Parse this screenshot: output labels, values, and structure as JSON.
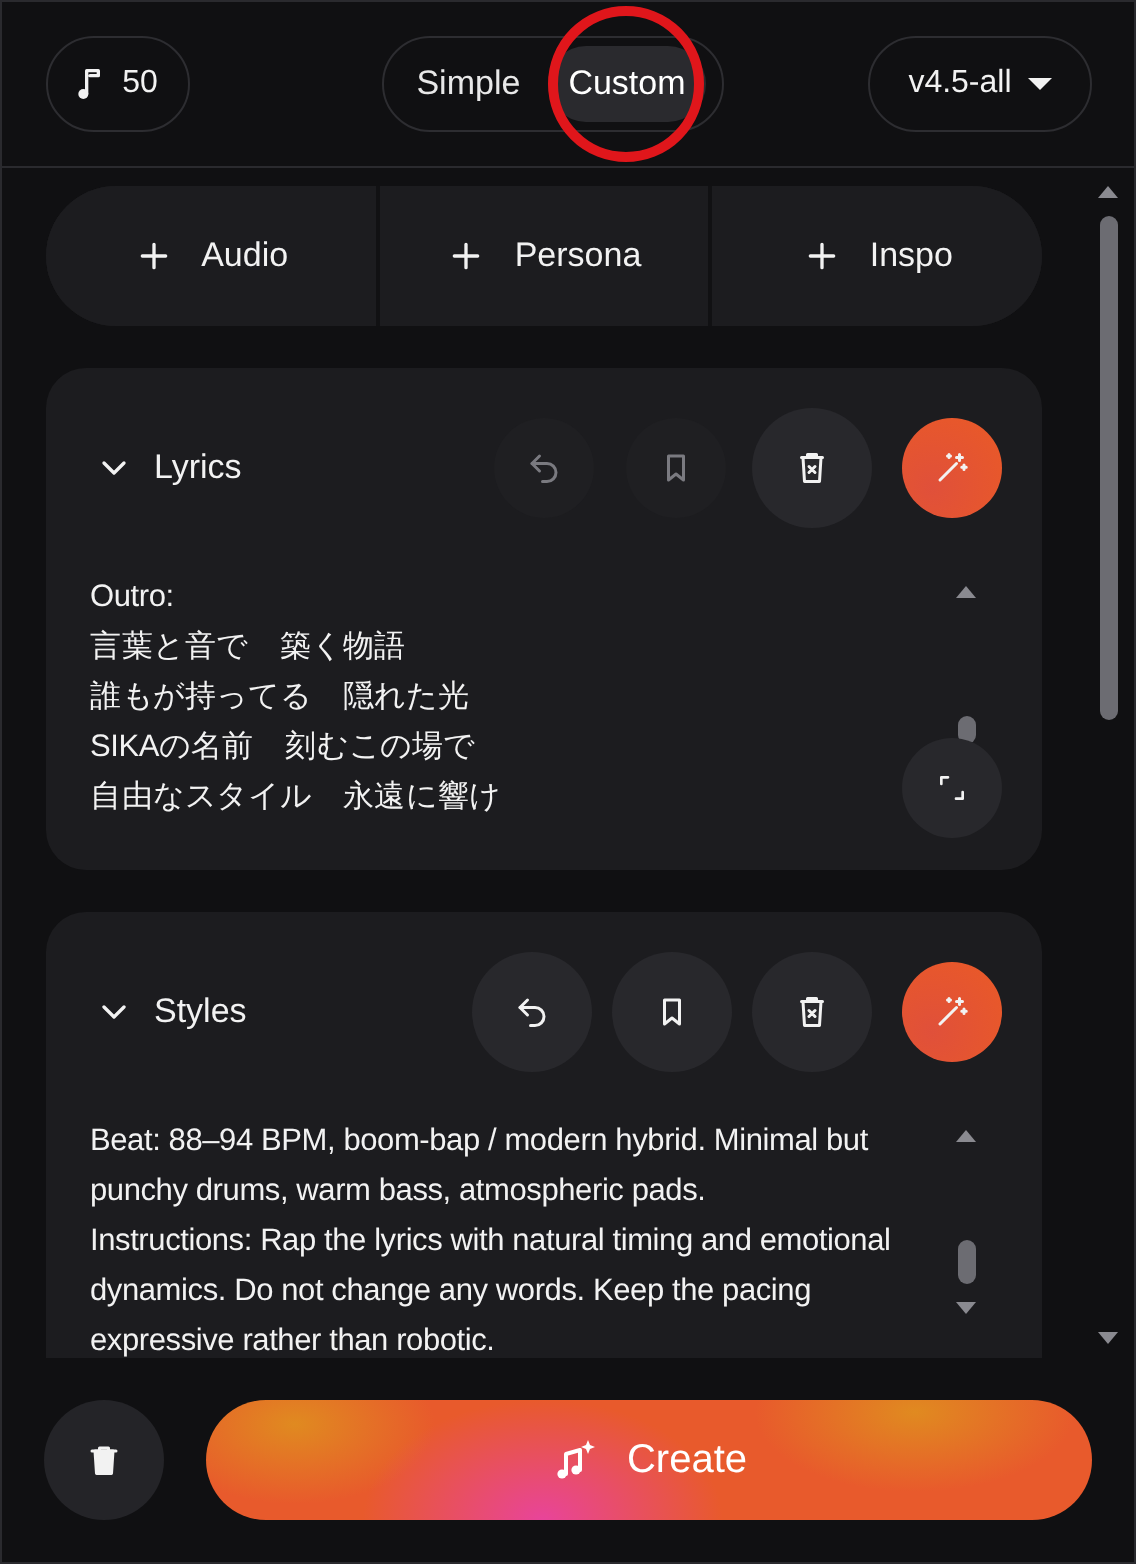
{
  "credits": {
    "text": "50"
  },
  "mode_tabs": [
    {
      "label": "Simple",
      "selected": false,
      "highlighted": false
    },
    {
      "label": "Custom",
      "selected": true,
      "highlighted": true
    }
  ],
  "model_select": {
    "value": "v4.5-all"
  },
  "add_buttons": [
    {
      "label": "Audio"
    },
    {
      "label": "Persona"
    },
    {
      "label": "Inspo"
    }
  ],
  "sections": [
    {
      "title": "Lyrics",
      "expanded": true,
      "actions": [
        {
          "kind": "undo",
          "disabled": true
        },
        {
          "kind": "bookmark",
          "disabled": true
        },
        {
          "kind": "clear",
          "disabled": false
        },
        {
          "kind": "magic",
          "disabled": false
        }
      ],
      "lines": [
        "Outro:",
        "言葉と音で　築く物語",
        "誰もが持ってる　隠れた光",
        "SIKAの名前　刻むこの場で",
        "自由なスタイル　永遠に響け"
      ],
      "expand_button": true
    },
    {
      "title": "Styles",
      "expanded": true,
      "actions": [
        {
          "kind": "undo",
          "disabled": false
        },
        {
          "kind": "bookmark",
          "disabled": false
        },
        {
          "kind": "clear",
          "disabled": false
        },
        {
          "kind": "magic",
          "disabled": false
        }
      ],
      "lines": [
        "Beat: 88–94 BPM, boom-bap / modern hybrid. Minimal but punchy drums, warm bass, atmospheric pads.",
        "Instructions: Rap the lyrics with natural timing and emotional dynamics. Do not change any words. Keep the pacing expressive rather than robotic."
      ],
      "expand_button": false
    }
  ],
  "create_button": {
    "label": "Create"
  }
}
